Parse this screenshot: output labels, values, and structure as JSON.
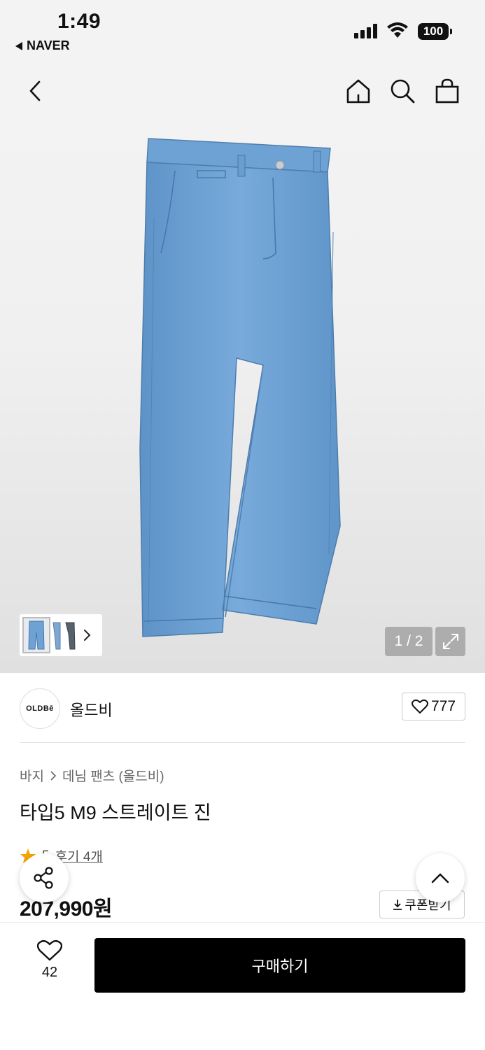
{
  "status_bar": {
    "time": "1:49",
    "back_app": "NAVER",
    "battery": "100"
  },
  "gallery": {
    "page_indicator": "1 / 2"
  },
  "store": {
    "logo_text": "OLDBē",
    "name": "올드비",
    "like_count": "777"
  },
  "breadcrumb": {
    "level1": "바지",
    "level2": "데님 팬츠 (올드비)"
  },
  "product": {
    "title": "타입5 M9 스트레이트 진",
    "rating": "5",
    "reviews_label": "후기 4개",
    "price": "207,990원"
  },
  "actions": {
    "coupon_label": "쿠폰받기",
    "wishlist_count": "42",
    "buy_label": "구매하기"
  },
  "colors": {
    "denim": "#6fa3d6",
    "buy_button": "#000000",
    "star": "#f5a300"
  }
}
